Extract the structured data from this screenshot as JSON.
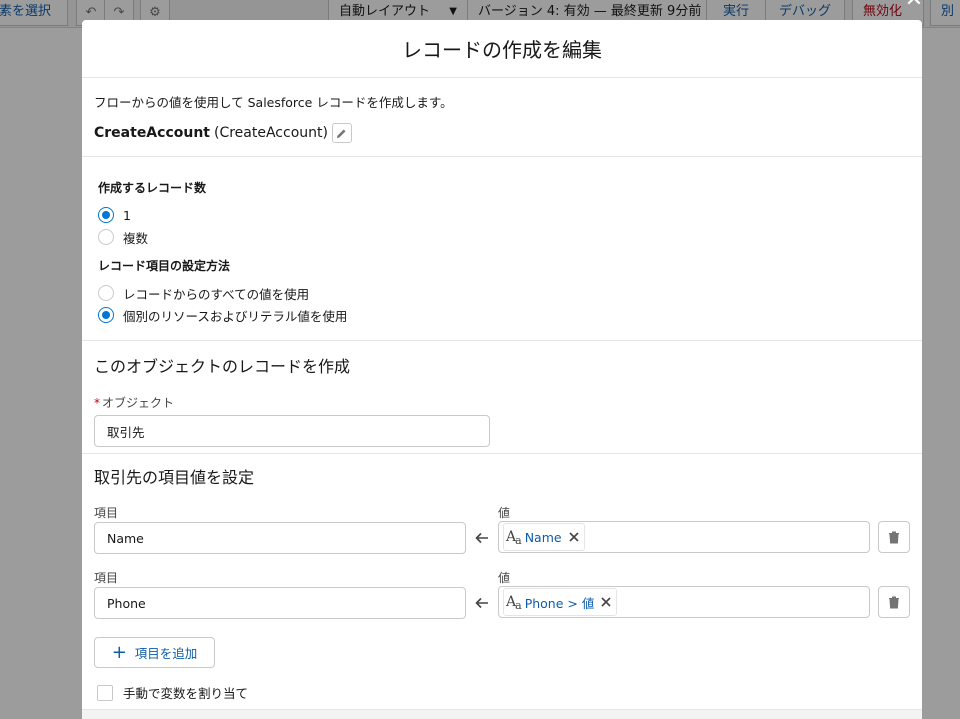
{
  "toolbar": {
    "select_label": "素を選択",
    "layout_label": "自動レイアウト",
    "version_label": "バージョン 4: 有効 — 最終更新 9分前",
    "run_label": "実行",
    "debug_label": "デバッグ",
    "deactivate_label": "無効化",
    "save_as_label": "別"
  },
  "modal": {
    "title": "レコードの作成を編集",
    "description": "フローからの値を使用して Salesforce レコードを作成します。",
    "element_label": "CreateAccount",
    "element_api": "(CreateAccount)"
  },
  "options": {
    "count_label": "作成するレコード数",
    "count_options": [
      "1",
      "複数"
    ],
    "count_selected": "1",
    "method_label": "レコード項目の設定方法",
    "method_options": [
      "レコードからのすべての値を使用",
      "個別のリソースおよびリテラル値を使用"
    ],
    "method_selected": "個別のリソースおよびリテラル値を使用"
  },
  "object_section": {
    "title": "このオブジェクトのレコードを作成",
    "required_mark": "*",
    "field_label": "オブジェクト",
    "value": "取引先"
  },
  "field_values": {
    "title": "取引先の項目値を設定",
    "field_col_label": "項目",
    "value_col_label": "値",
    "rows": [
      {
        "field": "Name",
        "value": "Name"
      },
      {
        "field": "Phone",
        "value": "Phone > 値"
      }
    ],
    "add_button": "項目を追加",
    "manual_assign_label": "手動で変数を割り当て",
    "manual_assign_checked": false
  },
  "icons": {
    "close": "close-icon",
    "edit": "pencil-icon",
    "arrow": "arrow-left-icon",
    "text_type": "text-type-icon",
    "remove": "close-icon",
    "delete": "trash-icon",
    "add": "plus-icon"
  },
  "colors": {
    "brand": "#0176d3",
    "link": "#0b5cab",
    "required": "#ba0517"
  }
}
